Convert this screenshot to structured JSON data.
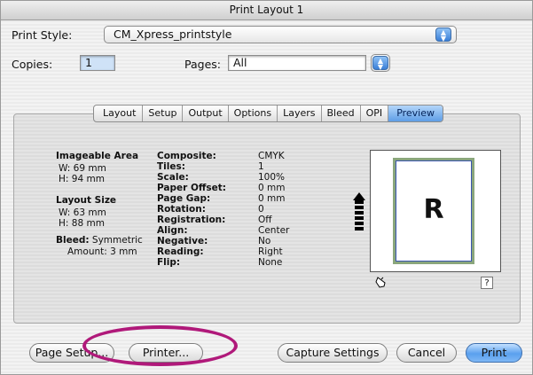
{
  "window": {
    "title": "Print Layout 1"
  },
  "print_style": {
    "label": "Print Style:",
    "value": "CM_Xpress_printstyle"
  },
  "copies": {
    "label": "Copies:",
    "value": "1"
  },
  "pages": {
    "label": "Pages:",
    "value": "All"
  },
  "tabs": [
    "Layout",
    "Setup",
    "Output",
    "Options",
    "Layers",
    "Bleed",
    "OPI",
    "Preview"
  ],
  "active_tab": "Preview",
  "left_info": {
    "imageable_area": {
      "heading": "Imageable Area",
      "w": "W: 69 mm",
      "h": "H: 94 mm"
    },
    "layout_size": {
      "heading": "Layout Size",
      "w": "W: 63 mm",
      "h": "H: 88 mm"
    },
    "bleed": {
      "heading": "Bleed:",
      "value": "Symmetric",
      "amount": "Amount: 3 mm"
    }
  },
  "details": [
    {
      "label": "Composite:",
      "value": "CMYK"
    },
    {
      "label": "Tiles:",
      "value": "1"
    },
    {
      "label": "Scale:",
      "value": "100%"
    },
    {
      "label": "Paper Offset:",
      "value": "0 mm"
    },
    {
      "label": "Page Gap:",
      "value": "0 mm"
    },
    {
      "label": "Rotation:",
      "value": "0"
    },
    {
      "label": "Registration:",
      "value": "Off"
    },
    {
      "label": "Align:",
      "value": "Center"
    },
    {
      "label": "Negative:",
      "value": "No"
    },
    {
      "label": "Reading:",
      "value": "Right"
    },
    {
      "label": "Flip:",
      "value": "None"
    }
  ],
  "preview": {
    "letter": "R",
    "help": "?"
  },
  "buttons": {
    "page_setup": "Page Setup...",
    "printer": "Printer...",
    "capture_settings": "Capture Settings",
    "cancel": "Cancel",
    "print": "Print"
  },
  "colors": {
    "highlight_circle": "#b0197a",
    "accent": "#5e9de6"
  }
}
